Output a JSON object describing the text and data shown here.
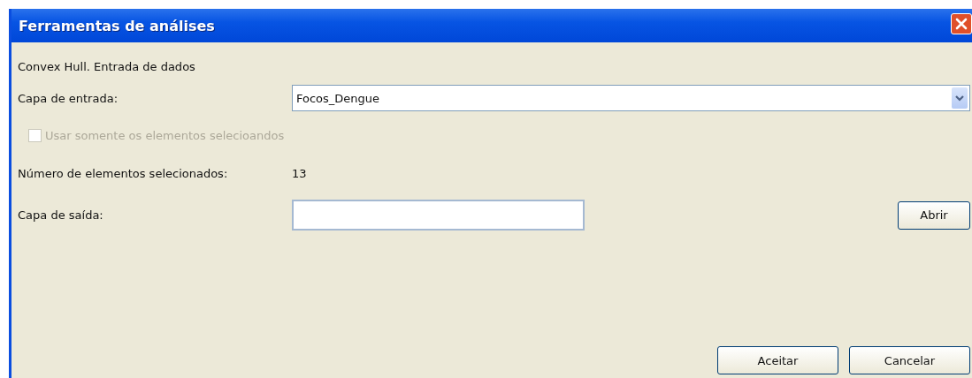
{
  "window": {
    "title": "Ferramentas de análises"
  },
  "subtitle": "Convex Hull. Entrada de dados",
  "input_layer": {
    "label": "Capa de entrada:",
    "value": "Focos_Dengue"
  },
  "checkbox": {
    "label": "Usar somente os elementos selecioandos",
    "checked": false,
    "disabled": true
  },
  "selected_count": {
    "label": "Número de elementos selecionados:",
    "value": "13"
  },
  "output_layer": {
    "label": "Capa de saída:",
    "button": "Abrir"
  },
  "buttons": [
    "Aceitar",
    "Cancelar"
  ]
}
